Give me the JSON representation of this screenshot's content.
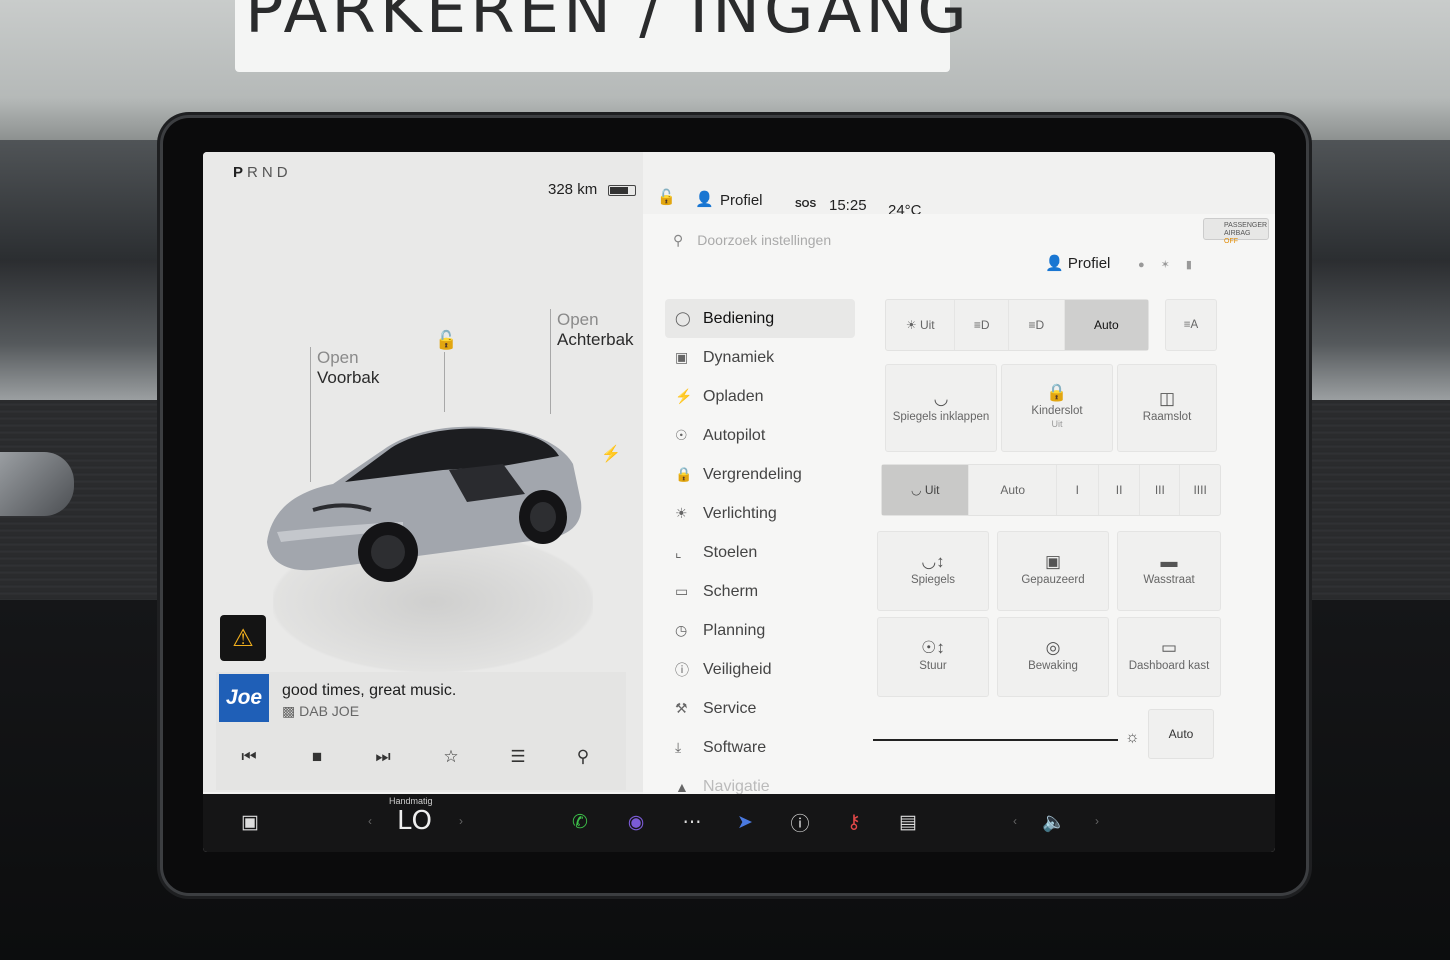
{
  "environment": {
    "sign_text": "PARKEREN / INGANG"
  },
  "car_panel": {
    "gear": [
      "P",
      "R",
      "N",
      "D"
    ],
    "active_gear": "P",
    "range": "328 km",
    "frunk": {
      "action": "Open",
      "name": "Voorbak"
    },
    "trunk": {
      "action": "Open",
      "name": "Achterbak"
    },
    "car_color": "#9fa3aa"
  },
  "media": {
    "station_logo": "Joe",
    "title": "good times, great music.",
    "source": "DAB JOE",
    "controls": [
      "previous-icon",
      "stop-icon",
      "next-icon",
      "favorite-icon",
      "equalizer-icon",
      "search-icon"
    ]
  },
  "status_bar": {
    "profile": "Profiel",
    "sos": "SOS",
    "time": "15:25",
    "temperature": "24°C"
  },
  "settings": {
    "search_placeholder": "Doorzoek instellingen",
    "profile": "Profiel",
    "airbag": {
      "line1": "PASSENGER",
      "line2": "AIRBAG",
      "state": "OFF"
    },
    "menu": [
      {
        "label": "Bediening",
        "icon": "toggle-icon",
        "active": true
      },
      {
        "label": "Dynamiek",
        "icon": "car-icon"
      },
      {
        "label": "Opladen",
        "icon": "bolt-icon"
      },
      {
        "label": "Autopilot",
        "icon": "steering-wheel-icon"
      },
      {
        "label": "Vergrendeling",
        "icon": "lock-icon"
      },
      {
        "label": "Verlichting",
        "icon": "sun-icon"
      },
      {
        "label": "Stoelen",
        "icon": "seat-icon"
      },
      {
        "label": "Scherm",
        "icon": "display-icon"
      },
      {
        "label": "Planning",
        "icon": "clock-icon"
      },
      {
        "label": "Veiligheid",
        "icon": "info-icon"
      },
      {
        "label": "Service",
        "icon": "wrench-icon"
      },
      {
        "label": "Software",
        "icon": "download-icon"
      },
      {
        "label": "Navigatie",
        "icon": "navigation-icon"
      }
    ],
    "lights": [
      "Uit",
      "",
      "",
      "Auto",
      ""
    ],
    "lights_selected": "Auto",
    "tiles_row1": [
      {
        "label": "Spiegels inklappen",
        "icon": "mirror-icon"
      },
      {
        "label": "Kinderslot",
        "sub": "Uit",
        "icon": "child-lock-icon"
      },
      {
        "label": "Raamslot",
        "icon": "window-lock-icon"
      }
    ],
    "wipers": [
      "Uit",
      "Auto",
      "I",
      "II",
      "III",
      "IIII"
    ],
    "wipers_selected": "Uit",
    "tiles_row2": [
      {
        "label": "Spiegels",
        "icon": "mirror-adjust-icon"
      },
      {
        "label": "Gepauzeerd",
        "icon": "dashcam-icon"
      },
      {
        "label": "Wasstraat",
        "icon": "carwash-icon"
      }
    ],
    "tiles_row3": [
      {
        "label": "Stuur",
        "icon": "steering-adjust-icon"
      },
      {
        "label": "Bewaking",
        "icon": "sentry-icon"
      },
      {
        "label": "Dashboard kast",
        "icon": "glovebox-icon"
      }
    ],
    "brightness_auto": "Auto"
  },
  "taskbar": {
    "climate_mode": "Handmatig",
    "climate_temp": "LO"
  }
}
